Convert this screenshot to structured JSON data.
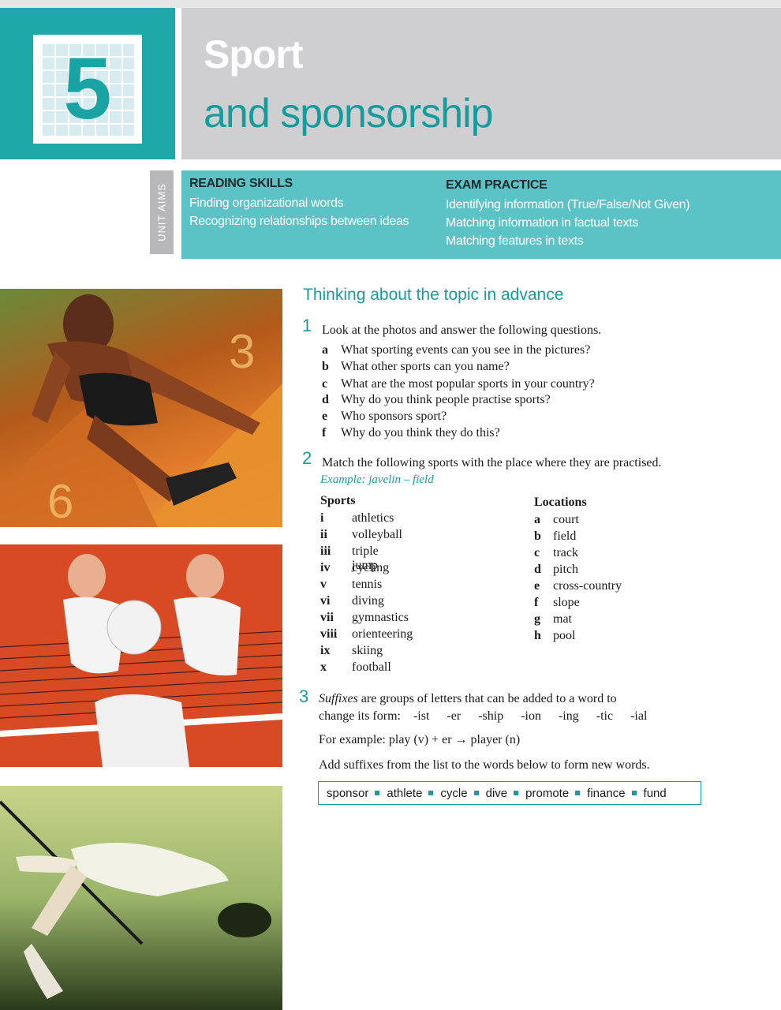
{
  "unit": {
    "number": "5"
  },
  "title": {
    "line1": "Sport",
    "line2": "and sponsorship"
  },
  "aims": {
    "tab_label": "UNIT AIMS",
    "reading": {
      "heading": "READING SKILLS",
      "items": [
        "Finding organizational words",
        "Recognizing relationships between ideas"
      ]
    },
    "exam": {
      "heading": "EXAM PRACTICE",
      "items": [
        "Identifying information (True/False/Not Given)",
        "Matching information in factual texts",
        "Matching features in texts"
      ]
    }
  },
  "section_title": "Thinking about the topic in advance",
  "q1": {
    "number": "1",
    "prompt": "Look at the photos and answer the following questions.",
    "items": [
      {
        "letter": "a",
        "text": "What sporting events can you see in the pictures?"
      },
      {
        "letter": "b",
        "text": "What other sports can you name?"
      },
      {
        "letter": "c",
        "text": "What are the most popular sports in your country?"
      },
      {
        "letter": "d",
        "text": "Why do you think people practise sports?"
      },
      {
        "letter": "e",
        "text": "Who sponsors sport?"
      },
      {
        "letter": "f",
        "text": "Why do you think they do this?"
      }
    ]
  },
  "q2": {
    "number": "2",
    "prompt": "Match the following sports with the place where they are practised.",
    "example": "Example: javelin – field",
    "sports_heading": "Sports",
    "locations_heading": "Locations",
    "sports": [
      {
        "num": "i",
        "name": "athletics"
      },
      {
        "num": "ii",
        "name": "volleyball"
      },
      {
        "num": "iii",
        "name": "triple jump"
      },
      {
        "num": "iv",
        "name": "cycling"
      },
      {
        "num": "v",
        "name": "tennis"
      },
      {
        "num": "vi",
        "name": "diving"
      },
      {
        "num": "vii",
        "name": "gymnastics"
      },
      {
        "num": "viii",
        "name": "orienteering"
      },
      {
        "num": "ix",
        "name": "skiing"
      },
      {
        "num": "x",
        "name": "football"
      }
    ],
    "locations": [
      {
        "letter": "a",
        "name": "court"
      },
      {
        "letter": "b",
        "name": "field"
      },
      {
        "letter": "c",
        "name": "track"
      },
      {
        "letter": "d",
        "name": "pitch"
      },
      {
        "letter": "e",
        "name": "cross-country"
      },
      {
        "letter": "f",
        "name": "slope"
      },
      {
        "letter": "g",
        "name": "mat"
      },
      {
        "letter": "h",
        "name": "pool"
      }
    ]
  },
  "q3": {
    "number": "3",
    "line1_term": "Suffixes",
    "line1_rest": " are groups of letters that can be added to a word to",
    "line2_lead": "change its form:",
    "suffixes": [
      "-ist",
      "-er",
      "-ship",
      "-ion",
      "-ing",
      "-tic",
      "-ial"
    ],
    "example_line": "For example: play (v) + er → player (n)",
    "instruction": "Add suffixes from the list to the words below to form new words.",
    "words": [
      "sponsor",
      "athlete",
      "cycle",
      "dive",
      "promote",
      "finance",
      "fund"
    ]
  }
}
